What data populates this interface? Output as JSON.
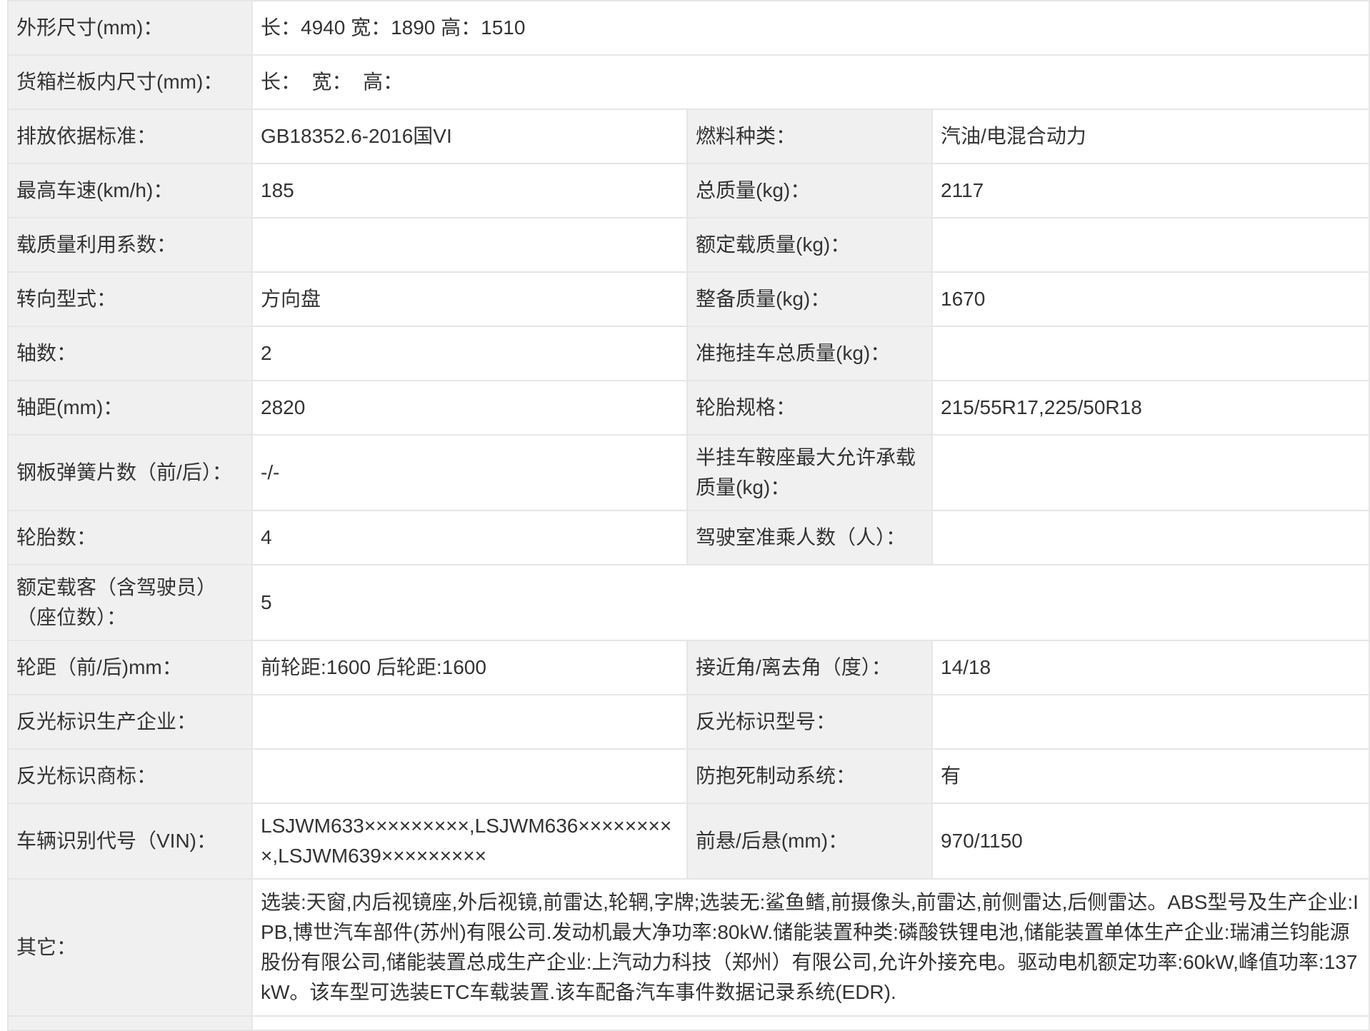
{
  "rows": [
    {
      "label": "外形尺寸(mm)：",
      "value": "长：4940 宽：1890 高：1510"
    },
    {
      "label": "货箱栏板内尺寸(mm)：",
      "value": "长：  宽：  高："
    },
    {
      "label": "排放依据标准：",
      "value": "GB18352.6-2016国VI",
      "label2": "燃料种类：",
      "value2": "汽油/电混合动力"
    },
    {
      "label": "最高车速(km/h)：",
      "value": "185",
      "label2": "总质量(kg)：",
      "value2": "2117"
    },
    {
      "label": "载质量利用系数：",
      "value": "",
      "label2": "额定载质量(kg)：",
      "value2": ""
    },
    {
      "label": "转向型式：",
      "value": "方向盘",
      "label2": "整备质量(kg)：",
      "value2": "1670"
    },
    {
      "label": "轴数：",
      "value": "2",
      "label2": "准拖挂车总质量(kg)：",
      "value2": ""
    },
    {
      "label": "轴距(mm)：",
      "value": "2820",
      "label2": "轮胎规格：",
      "value2": "215/55R17,225/50R18"
    },
    {
      "label": "钢板弹簧片数（前/后）：",
      "value": "-/-",
      "label2": "半挂车鞍座最大允许承载质量(kg)：",
      "value2": ""
    },
    {
      "label": "轮胎数：",
      "value": "4",
      "label2": "驾驶室准乘人数（人）：",
      "value2": ""
    },
    {
      "label": "额定载客（含驾驶员）（座位数）：",
      "value": "5"
    },
    {
      "label": "轮距（前/后)mm：",
      "value": "前轮距:1600 后轮距:1600",
      "label2": "接近角/离去角（度）：",
      "value2": "14/18"
    },
    {
      "label": "反光标识生产企业：",
      "value": "",
      "label2": "反光标识型号：",
      "value2": ""
    },
    {
      "label": "反光标识商标：",
      "value": "",
      "label2": "防抱死制动系统：",
      "value2": "有"
    },
    {
      "label": "车辆识别代号（VIN)：",
      "value": "LSJWM633×××××××××,LSJWM636×××××××××,LSJWM639×××××××××",
      "label2": "前悬/后悬(mm)：",
      "value2": "970/1150"
    },
    {
      "label": "其它：",
      "value": "选装:天窗,内后视镜座,外后视镜,前雷达,轮辋,字牌;选装无:鲨鱼鳍,前摄像头,前雷达,前侧雷达,后侧雷达。ABS型号及生产企业:IPB,博世汽车部件(苏州)有限公司.发动机最大净功率:80kW.储能装置种类:磷酸铁锂电池,储能装置单体生产企业:瑞浦兰钧能源股份有限公司,储能装置总成生产企业:上汽动力科技（郑州）有限公司,允许外接充电。驱动电机额定功率:60kW,峰值功率:137kW。该车型可选装ETC车载装置.该车配备汽车事件数据记录系统(EDR)."
    },
    {
      "label": "",
      "value": ""
    }
  ]
}
